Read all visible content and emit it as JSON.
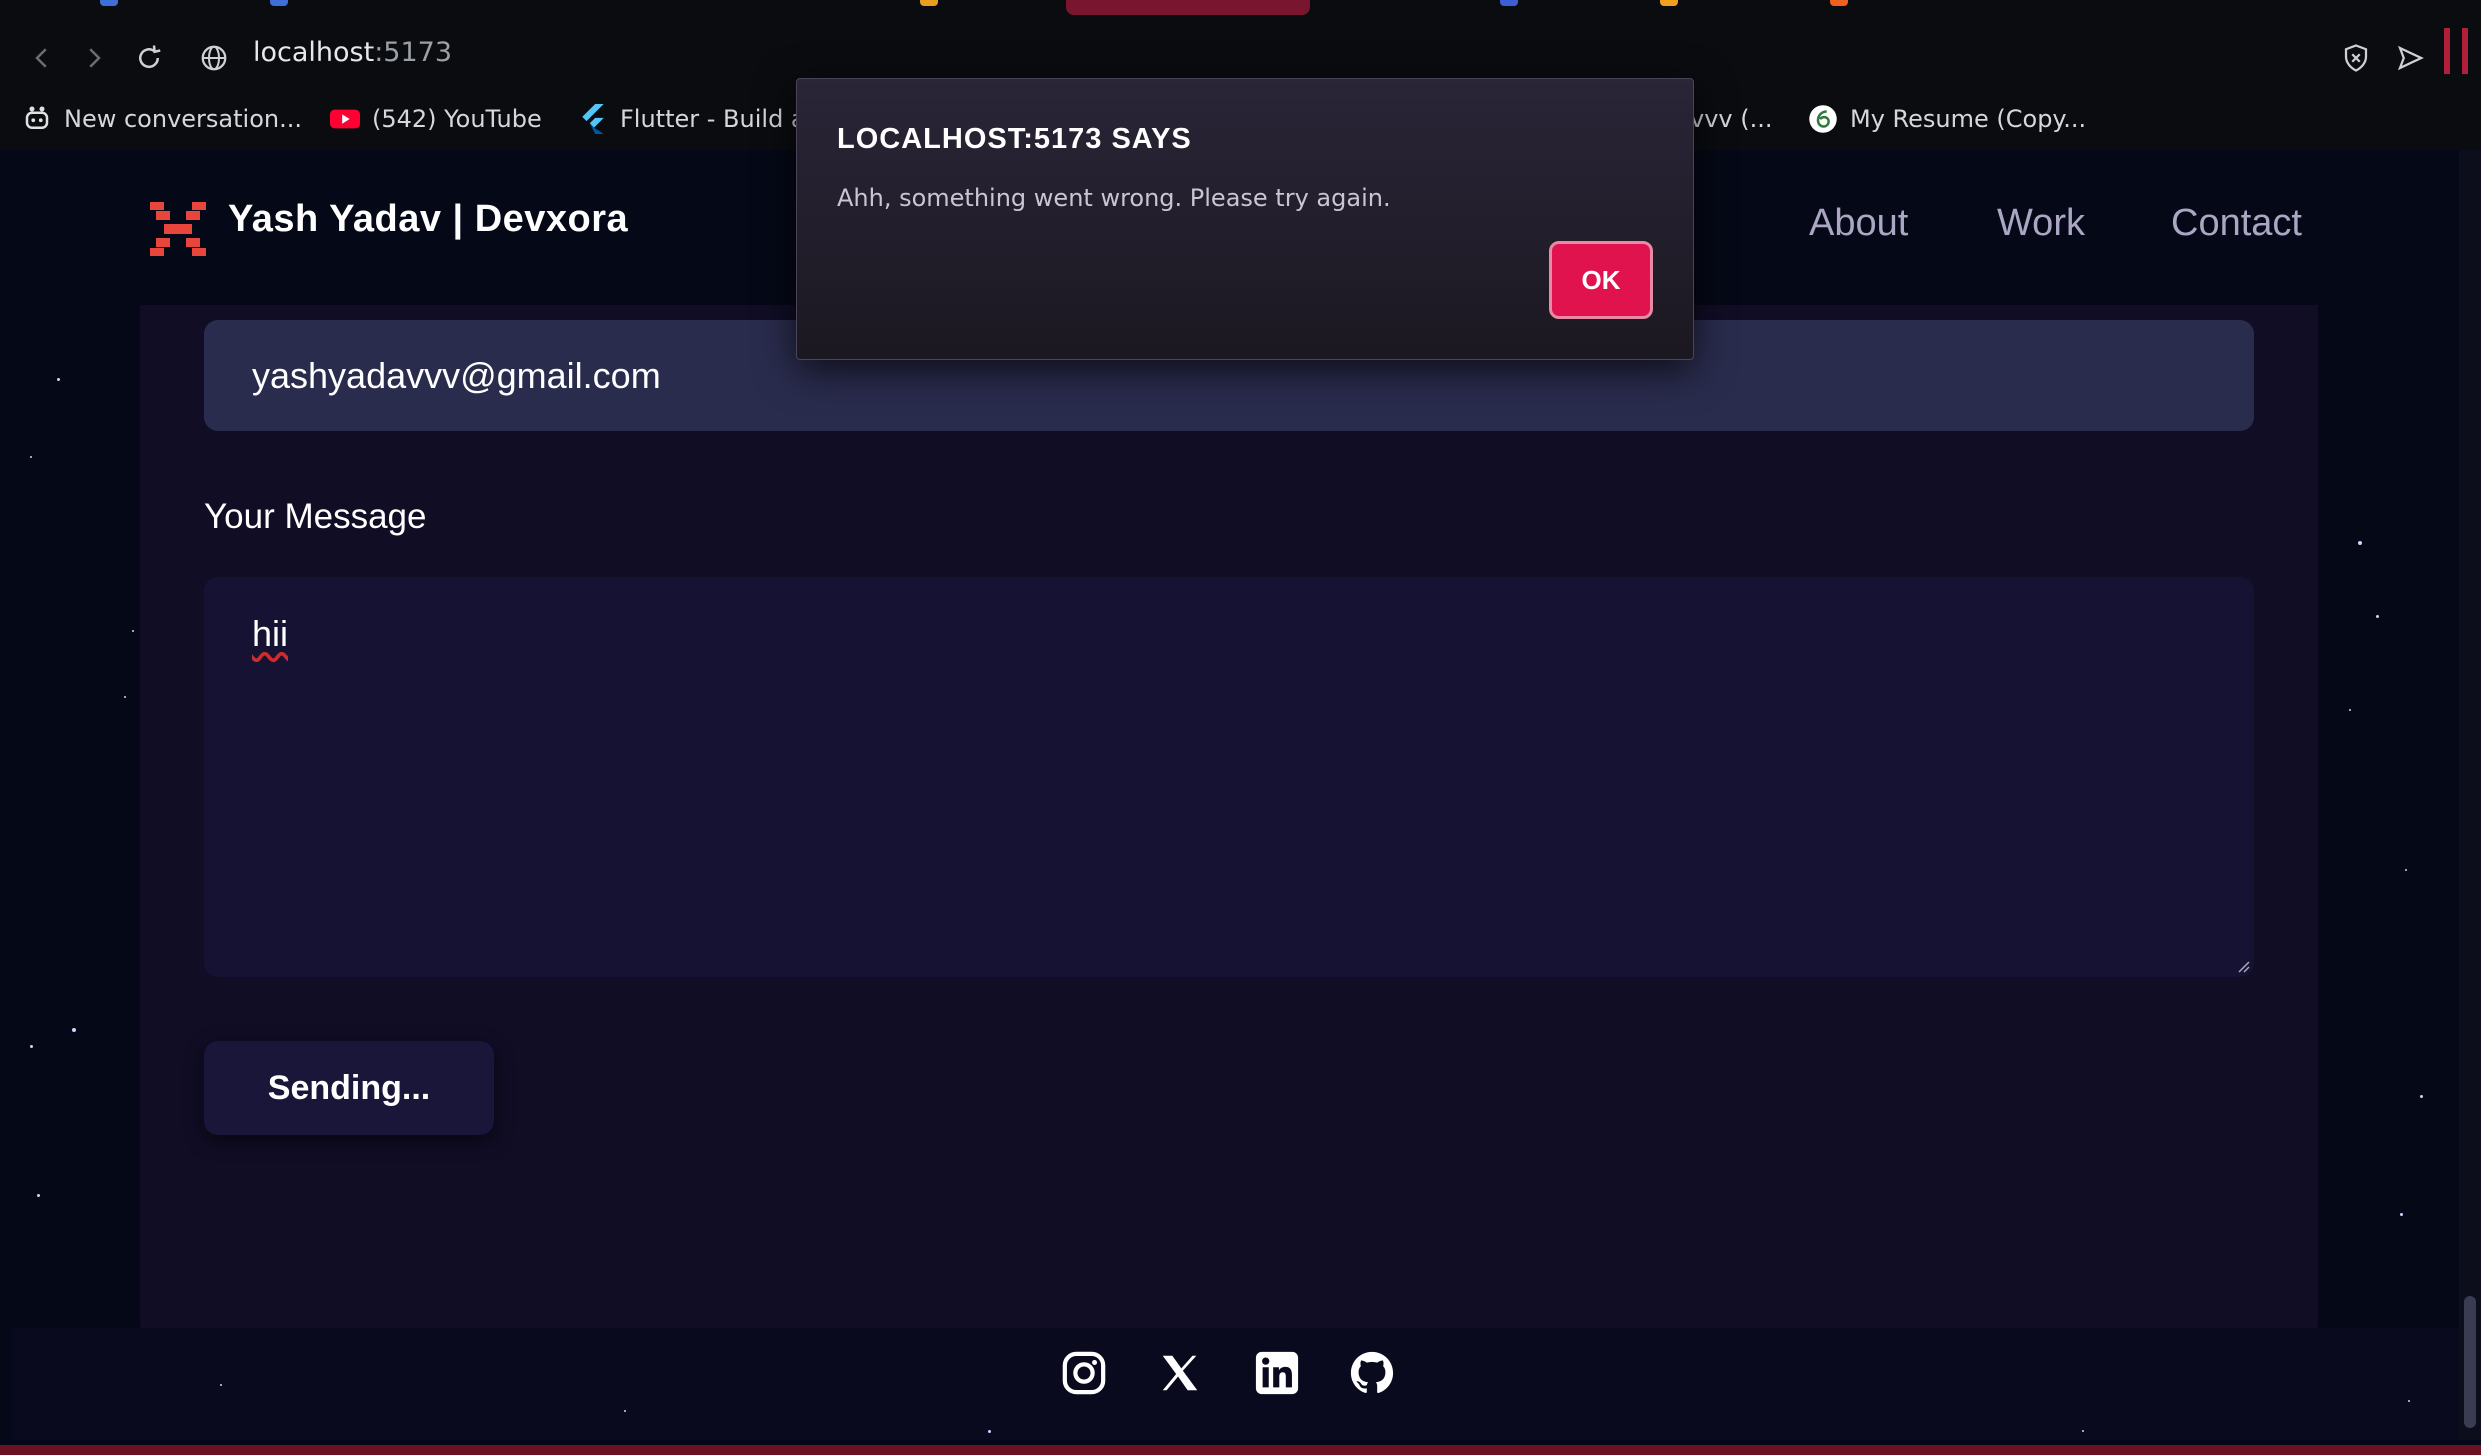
{
  "browser": {
    "url_host": "localhost",
    "url_port": ":5173",
    "bookmarks": [
      {
        "label": "New conversation...",
        "icon": "bot-icon"
      },
      {
        "label": "(542) YouTube",
        "icon": "youtube-icon"
      },
      {
        "label": "Flutter - Build ap",
        "icon": "flutter-icon"
      },
      {
        "label": "vvv (...",
        "icon": ""
      },
      {
        "label": "My Resume (Copy...",
        "icon": "resume-icon"
      }
    ]
  },
  "site": {
    "brand": "Yash Yadav | Devxora",
    "nav": [
      "About",
      "Work",
      "Contact"
    ]
  },
  "form": {
    "email_value": "yashyadavvv@gmail.com",
    "message_label": "Your Message",
    "message_value": "hii",
    "submit_label": "Sending..."
  },
  "dialog": {
    "title": "LOCALHOST:5173 SAYS",
    "message": "Ahh, something went wrong. Please try again.",
    "ok_label": "OK"
  },
  "footer": {
    "socials": [
      "instagram-icon",
      "x-icon",
      "linkedin-icon",
      "github-icon"
    ]
  },
  "colors": {
    "accent": "#e0134f",
    "logo": "#e8453c",
    "background": "#050816",
    "card": "#100d25"
  }
}
